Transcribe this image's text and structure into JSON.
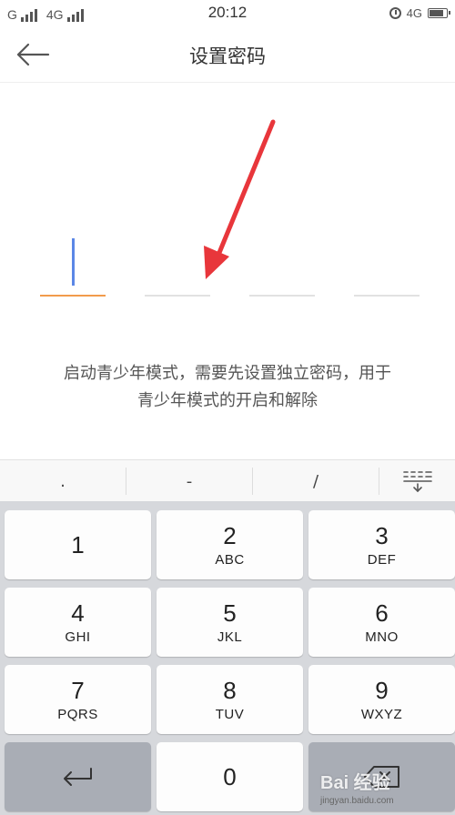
{
  "status_bar": {
    "carrier1": "G",
    "carrier2": "4G",
    "time": "20:12",
    "network_right": "4G"
  },
  "header": {
    "title": "设置密码"
  },
  "pin": {
    "length": 4,
    "filled": 0,
    "active_index": 0
  },
  "hint": {
    "line1": "启动青少年模式，需要先设置独立密码，用于",
    "line2": "青少年模式的开启和解除"
  },
  "keyboard": {
    "symbols": [
      ".",
      "-",
      "/"
    ],
    "keys": [
      {
        "num": "1",
        "letters": ""
      },
      {
        "num": "2",
        "letters": "ABC"
      },
      {
        "num": "3",
        "letters": "DEF"
      },
      {
        "num": "4",
        "letters": "GHI"
      },
      {
        "num": "5",
        "letters": "JKL"
      },
      {
        "num": "6",
        "letters": "MNO"
      },
      {
        "num": "7",
        "letters": "PQRS"
      },
      {
        "num": "8",
        "letters": "TUV"
      },
      {
        "num": "9",
        "letters": "WXYZ"
      },
      {
        "num": "0",
        "letters": ""
      }
    ]
  },
  "watermark": {
    "main": "Bai 经验",
    "sub": "jingyan.baidu.com"
  },
  "colors": {
    "accent_orange": "#f29b4c",
    "cursor_blue": "#5b87e6",
    "arrow_red": "#e8363b"
  }
}
